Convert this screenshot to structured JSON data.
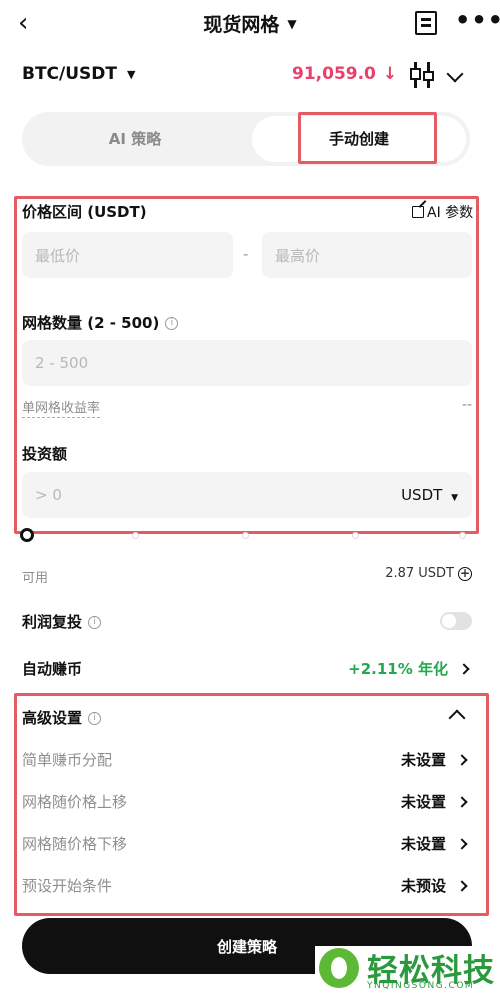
{
  "header": {
    "title": "现货网格",
    "back_glyph": "‹",
    "more_glyph": "•••",
    "caret_glyph": "▼"
  },
  "pair": {
    "symbol": "BTC/USDT",
    "price": "91,059.0",
    "price_arrow": "↓",
    "price_color": "#e8416b"
  },
  "mode": {
    "ai_label": "AI 策略",
    "manual_label": "手动创建",
    "selected": "manual"
  },
  "price_range": {
    "label": "价格区间 (USDT)",
    "ai_params": "AI 参数",
    "min_placeholder": "最低价",
    "max_placeholder": "最高价",
    "separator": "-"
  },
  "grid_count": {
    "label": "网格数量 (2 - 500)",
    "placeholder": "2 - 500"
  },
  "grid_yield": {
    "label": "单网格收益率",
    "value": "--"
  },
  "investment": {
    "label": "投资额",
    "placeholder": "> 0",
    "currency": "USDT"
  },
  "available": {
    "label": "可用",
    "value": "2.87 USDT"
  },
  "reinvest": {
    "label": "利润复投",
    "enabled": false
  },
  "auto_earn": {
    "label": "自动赚币",
    "rate": "+2.11% 年化",
    "rate_color": "#25a750"
  },
  "advanced": {
    "title": "高级设置",
    "items": [
      {
        "label": "简单赚币分配",
        "value": "未设置"
      },
      {
        "label": "网格随价格上移",
        "value": "未设置"
      },
      {
        "label": "网格随价格下移",
        "value": "未设置"
      },
      {
        "label": "预设开始条件",
        "value": "未预设"
      }
    ]
  },
  "create_button": "创建策略",
  "watermark": {
    "name": "轻松科技",
    "domain": "YNQINGSONG.COM"
  }
}
